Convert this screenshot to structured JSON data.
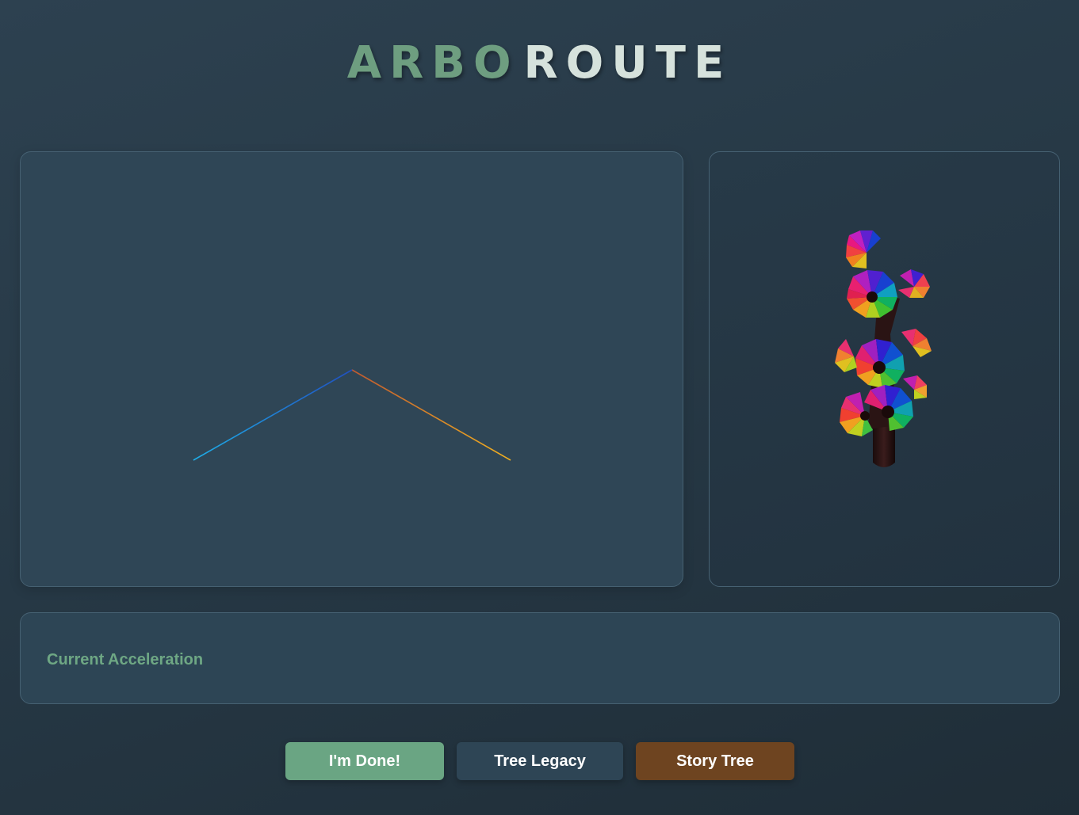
{
  "header": {
    "title_part1": "ARBO",
    "title_part2": "ROUTE"
  },
  "acceleration_panel": {
    "label": "Current Acceleration"
  },
  "buttons": {
    "done": "I'm Done!",
    "legacy": "Tree Legacy",
    "story": "Story Tree"
  },
  "colors": {
    "accent_green": "#6aa583",
    "legacy_button": "#2e4555",
    "story_button": "#6e4420",
    "axis_y": "#9acd32",
    "axis_x": "#f0a020",
    "axis_z": "#1e9ee0"
  },
  "icons": {
    "axes_view": "3d-axes-icon",
    "tree_view": "tree-model-icon"
  }
}
